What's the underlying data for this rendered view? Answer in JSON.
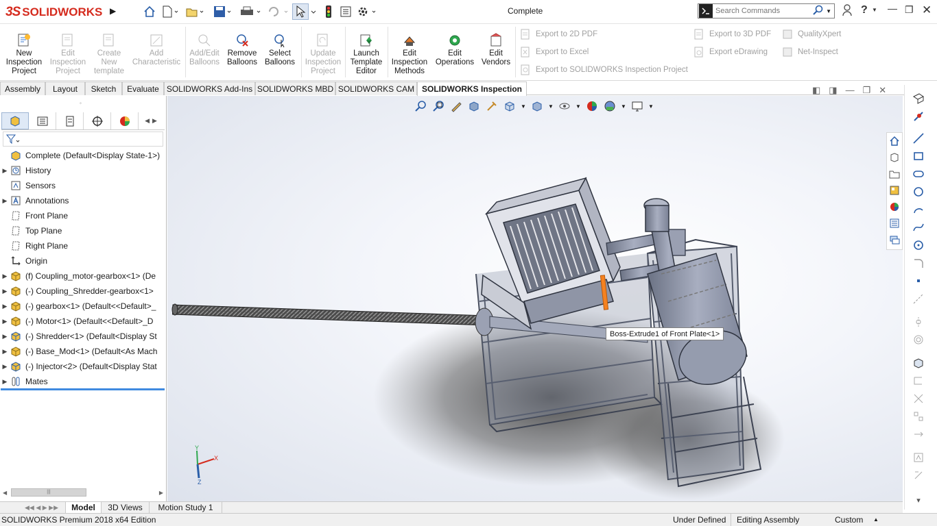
{
  "app": {
    "brand_prefix": "3S",
    "brand": "SOLIDWORKS",
    "window_title": "Complete"
  },
  "search": {
    "placeholder": "Search Commands"
  },
  "ribbon": {
    "buttons": [
      {
        "label": "New\nInspection\nProject",
        "enabled": true
      },
      {
        "label": "Edit\nInspection\nProject",
        "enabled": false
      },
      {
        "label": "Create\nNew\ntemplate",
        "enabled": false
      },
      {
        "label": "Add\nCharacteristic",
        "enabled": false
      },
      {
        "label": "Add/Edit\nBalloons",
        "enabled": false
      },
      {
        "label": "Remove\nBalloons",
        "enabled": true
      },
      {
        "label": "Select\nBalloons",
        "enabled": true
      },
      {
        "label": "Update\nInspection\nProject",
        "enabled": false
      },
      {
        "label": "Launch\nTemplate\nEditor",
        "enabled": true
      },
      {
        "label": "Edit\nInspection\nMethods",
        "enabled": true
      },
      {
        "label": "Edit\nOperations",
        "enabled": true
      },
      {
        "label": "Edit\nVendors",
        "enabled": true
      }
    ],
    "exports": [
      "Export to 2D PDF",
      "Export to Excel",
      "Export to SOLIDWORKS Inspection Project",
      "Export to 3D PDF",
      "Export eDrawing",
      "QualityXpert",
      "Net-Inspect"
    ]
  },
  "command_tabs": [
    "Assembly",
    "Layout",
    "Sketch",
    "Evaluate",
    "SOLIDWORKS Add-Ins",
    "SOLIDWORKS MBD",
    "SOLIDWORKS CAM",
    "SOLIDWORKS Inspection"
  ],
  "active_command_tab": "SOLIDWORKS Inspection",
  "tree": {
    "root": "Complete  (Default<Display State-1>)",
    "nodes": [
      {
        "label": "History",
        "icon": "history-icon",
        "expandable": true
      },
      {
        "label": "Sensors",
        "icon": "sensors-icon",
        "expandable": false
      },
      {
        "label": "Annotations",
        "icon": "annotations-icon",
        "expandable": true
      },
      {
        "label": "Front Plane",
        "icon": "plane-icon",
        "expandable": false
      },
      {
        "label": "Top Plane",
        "icon": "plane-icon",
        "expandable": false
      },
      {
        "label": "Right Plane",
        "icon": "plane-icon",
        "expandable": false
      },
      {
        "label": "Origin",
        "icon": "origin-icon",
        "expandable": false
      },
      {
        "label": "(f) Coupling_motor-gearbox<1> (De",
        "icon": "part-icon",
        "expandable": true
      },
      {
        "label": "(-) Coupling_Shredder-gearbox<1>",
        "icon": "part-icon",
        "expandable": true
      },
      {
        "label": "(-) gearbox<1> (Default<<Default>_",
        "icon": "part-icon",
        "expandable": true
      },
      {
        "label": "(-) Motor<1> (Default<<Default>_D",
        "icon": "part-icon",
        "expandable": true
      },
      {
        "label": "(-) Shredder<1> (Default<Display St",
        "icon": "assembly-icon",
        "expandable": true
      },
      {
        "label": "(-) Base_Mod<1> (Default<As Mach",
        "icon": "part-icon",
        "expandable": true
      },
      {
        "label": "(-) Injector<2> (Default<Display Stat",
        "icon": "assembly-icon",
        "expandable": true
      },
      {
        "label": "Mates",
        "icon": "mates-icon",
        "expandable": true
      }
    ]
  },
  "tooltip": "Boss-Extrude1 of Front Plate<1>",
  "triad": {
    "x": "X",
    "y": "Y",
    "z": "Z"
  },
  "bottom_tabs": [
    "Model",
    "3D Views",
    "Motion Study 1"
  ],
  "active_bottom_tab": "Model",
  "status": {
    "edition": "SOLIDWORKS Premium 2018 x64 Edition",
    "definition": "Under Defined",
    "mode": "Editing Assembly",
    "units": "Custom"
  },
  "colors": {
    "brand": "#d52b1e",
    "selection": "#3f8ae0",
    "highlight": "#f58220",
    "model": "#8d94a8"
  }
}
